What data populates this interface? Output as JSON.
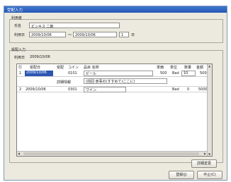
{
  "window": {
    "title": "受配入力"
  },
  "customer": {
    "group_label": "利用者",
    "name_label": "氏名",
    "name_value": "ビンキス 二郎",
    "period_label": "利用日",
    "period_from": "2009/10/06",
    "period_sep": "〜",
    "period_to": "2009/10/06",
    "days": "1",
    "days_unit": "日"
  },
  "order": {
    "group_label": "受配入力",
    "date_label": "利用日",
    "date_value": "2009/10/06"
  },
  "grid": {
    "columns": [
      "行",
      "受配日",
      "受配",
      "コイン",
      "品目 名称",
      "単価",
      "単位",
      "数量",
      "金額"
    ],
    "rows": [
      {
        "no": "1",
        "date": "2009/10/06",
        "code": "0101",
        "item": "ビール",
        "unit_price": "500",
        "unit": "Bad",
        "qty": "10",
        "amount": "5000"
      },
      {
        "no": "2",
        "date": "2009/10/06",
        "code": "0301",
        "item": "ワイン",
        "unit_price": "0",
        "unit": "Bad",
        "qty": "0",
        "amount": "5000"
      }
    ],
    "memo_label": "詳細情報",
    "memo_placeholder": "(前回 食事の(すすめて)ここに)"
  },
  "buttons": {
    "detail": "詳細変更",
    "ok": "登録(J)",
    "cancel": "中止(C)"
  }
}
